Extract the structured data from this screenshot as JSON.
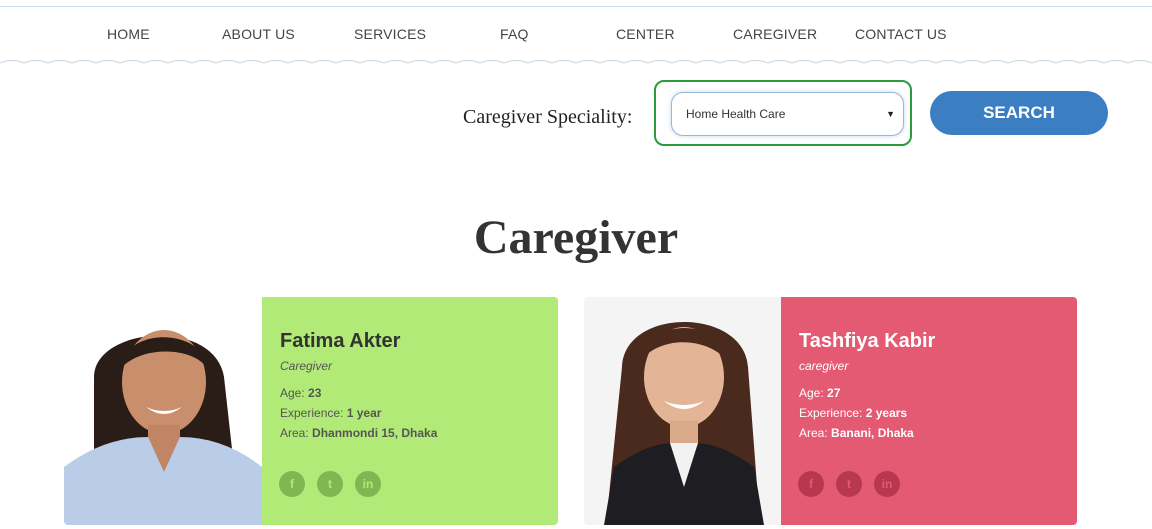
{
  "nav": {
    "items": [
      {
        "label": "HOME"
      },
      {
        "label": "ABOUT US"
      },
      {
        "label": "SERVICES"
      },
      {
        "label": "FAQ"
      },
      {
        "label": "CENTER"
      },
      {
        "label": "CAREGIVER"
      },
      {
        "label": "CONTACT US"
      }
    ]
  },
  "search": {
    "label": "Caregiver Speciality:",
    "selected": "Home Health Care",
    "button_label": "SEARCH"
  },
  "page": {
    "title": "Caregiver"
  },
  "caregivers": [
    {
      "name": "Fatima Akter",
      "role": "Caregiver",
      "age_label": "Age:",
      "age": "23",
      "experience_label": "Experience:",
      "experience": "1 year",
      "area_label": "Area:",
      "area": "Dhanmondi 15, Dhaka",
      "card_color": "#b1ea76",
      "social": [
        {
          "icon": "facebook-icon",
          "glyph": "f"
        },
        {
          "icon": "twitter-icon",
          "glyph": "t"
        },
        {
          "icon": "linkedin-icon",
          "glyph": "in"
        }
      ]
    },
    {
      "name": "Tashfiya Kabir",
      "role": "caregiver",
      "age_label": "Age:",
      "age": "27",
      "experience_label": "Experience:",
      "experience": "2 years",
      "area_label": "Area:",
      "area": "Banani, Dhaka",
      "card_color": "#e45a72",
      "social": [
        {
          "icon": "facebook-icon",
          "glyph": "f"
        },
        {
          "icon": "twitter-icon",
          "glyph": "t"
        },
        {
          "icon": "linkedin-icon",
          "glyph": "in"
        }
      ]
    }
  ],
  "colors": {
    "accent_blue": "#3b7ec1",
    "highlight_green": "#2e9a3e"
  }
}
